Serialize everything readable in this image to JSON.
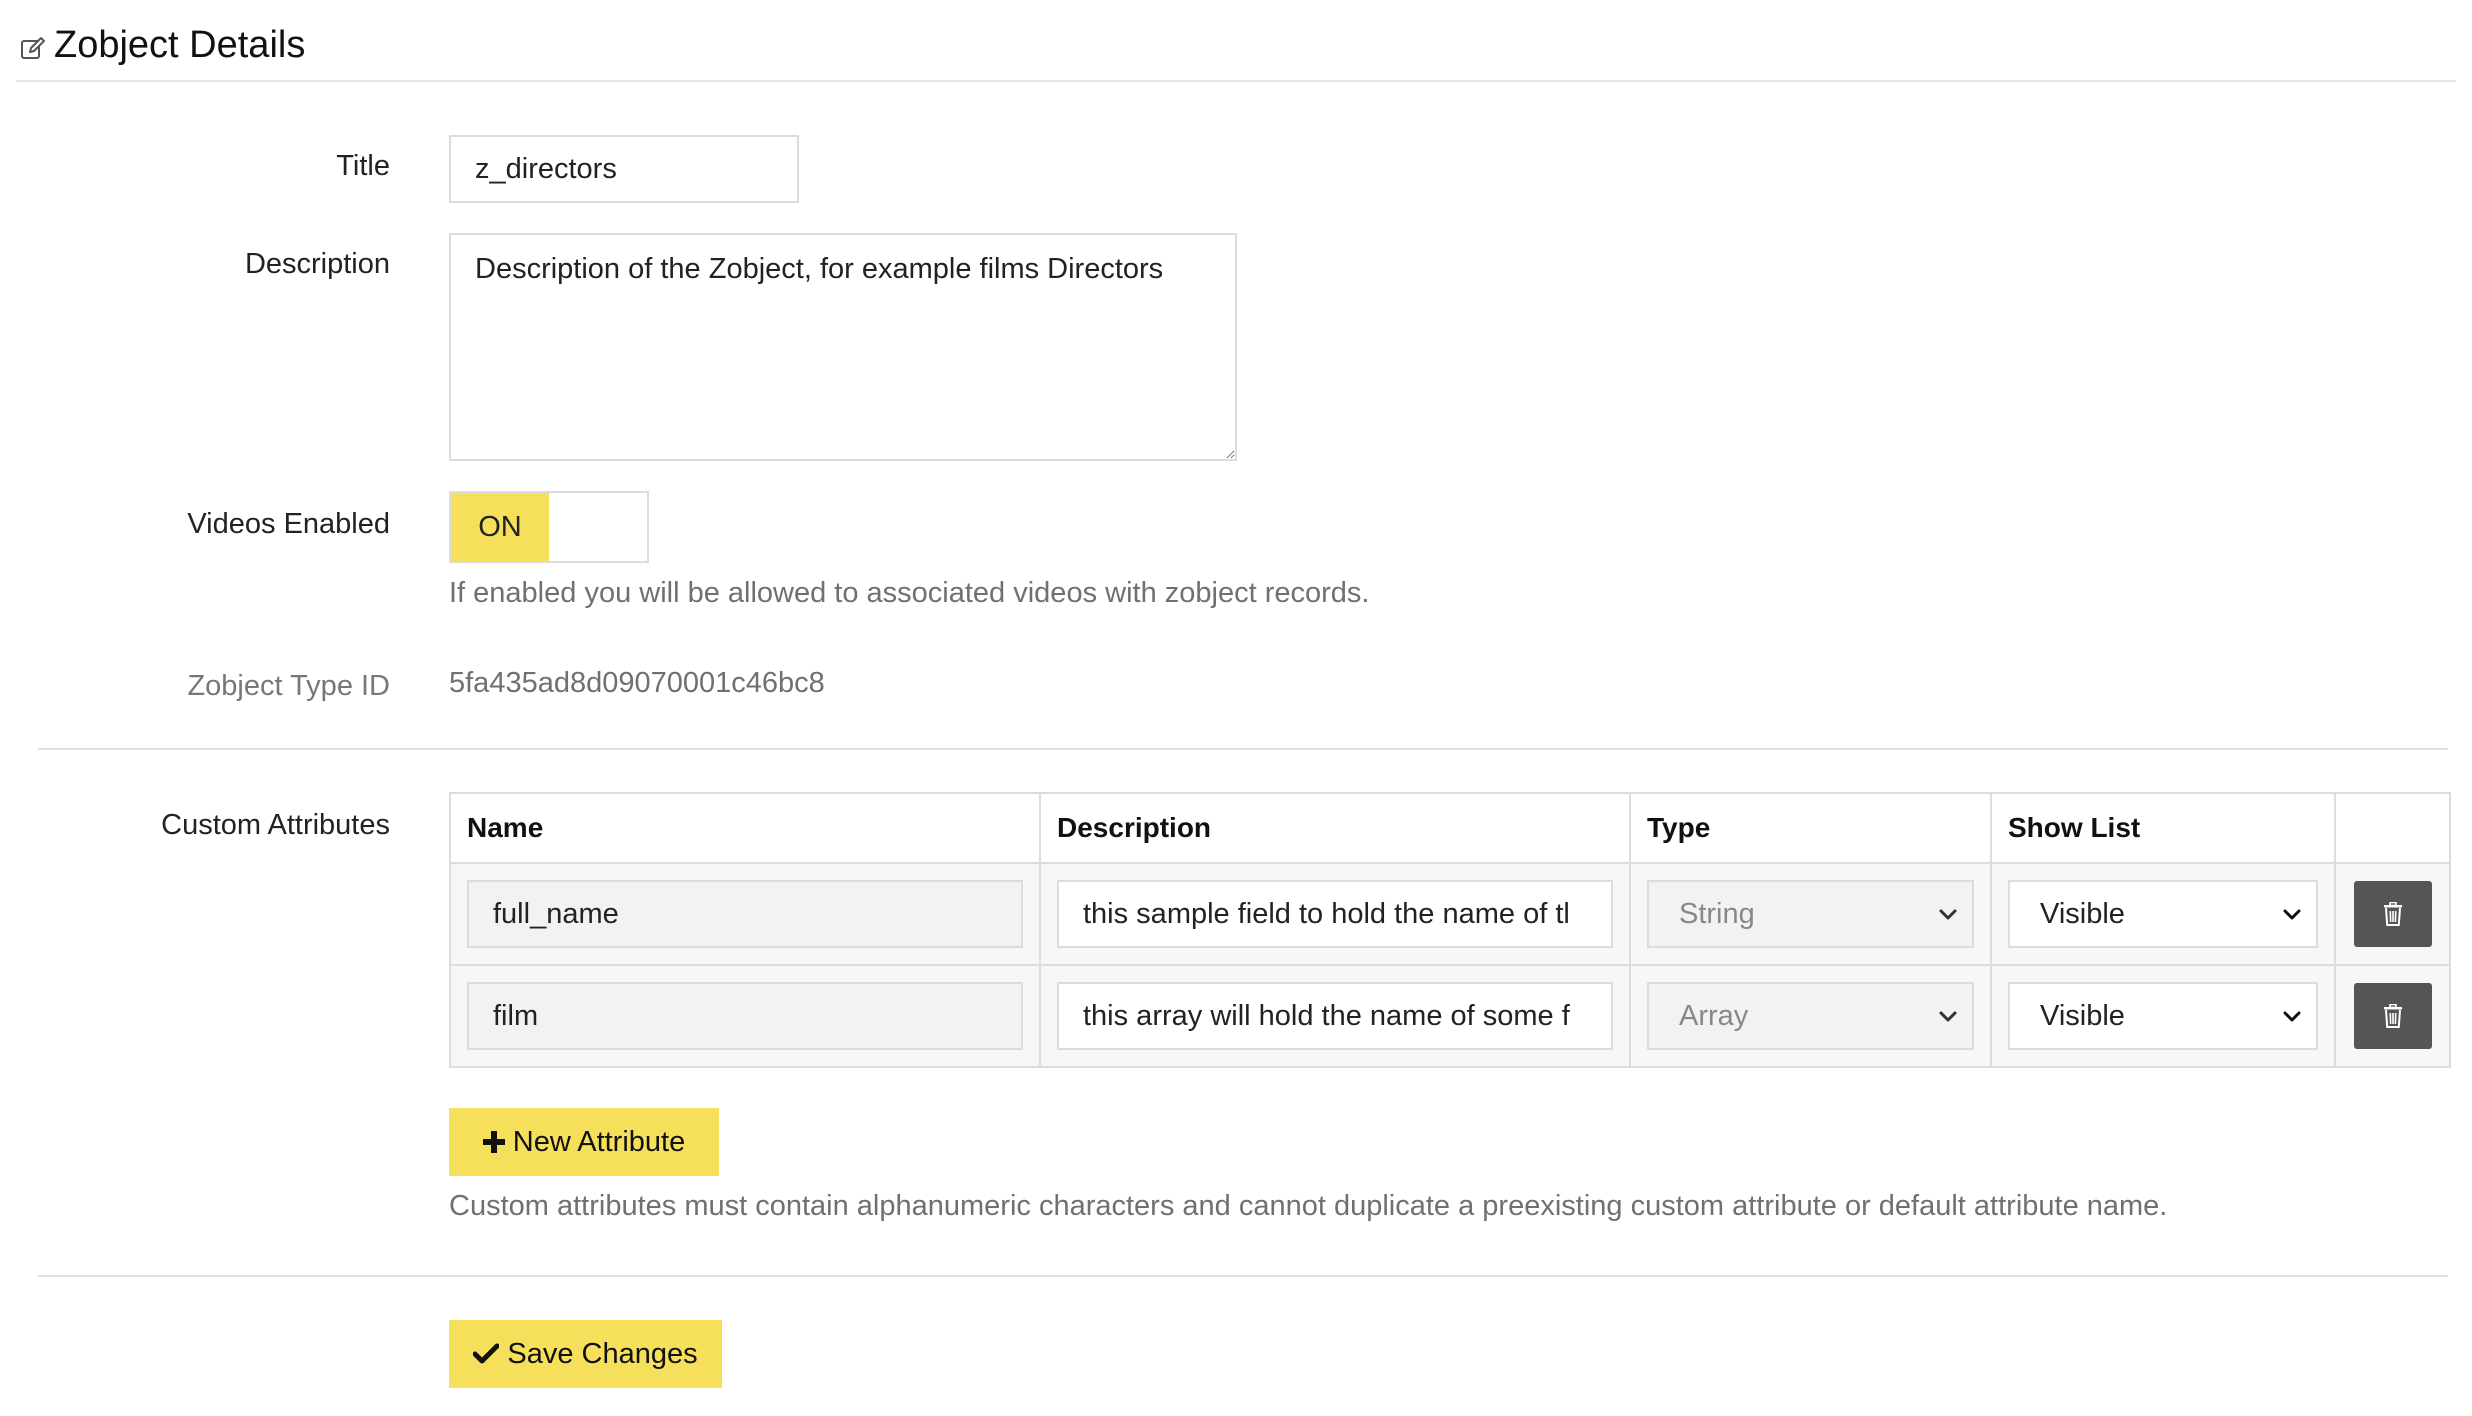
{
  "header": {
    "icon": "edit-icon",
    "title": "Zobject Details"
  },
  "form": {
    "title_label": "Title",
    "title_value": "z_directors",
    "description_label": "Description",
    "description_value": "Description of the Zobject, for example films Directors",
    "videos_label": "Videos Enabled",
    "videos_toggle": "ON",
    "videos_help": "If enabled you will be allowed to associated videos with zobject records.",
    "type_id_label": "Zobject Type ID",
    "type_id_value": "5fa435ad8d09070001c46bc8"
  },
  "custom_attributes": {
    "label": "Custom Attributes",
    "columns": [
      "Name",
      "Description",
      "Type",
      "Show List",
      ""
    ],
    "rows": [
      {
        "name": "full_name",
        "description": "this sample field to hold the name of tl",
        "type": "String",
        "show_list": "Visible"
      },
      {
        "name": "film",
        "description": "this array will hold the name of some f",
        "type": "Array",
        "show_list": "Visible"
      }
    ],
    "new_button": "New Attribute",
    "help": "Custom attributes must contain alphanumeric characters and cannot duplicate a preexisting custom attribute or default attribute name."
  },
  "actions": {
    "save_label": "Save Changes"
  },
  "colors": {
    "accent_yellow": "#f5df5b",
    "trash_button": "#555555"
  }
}
